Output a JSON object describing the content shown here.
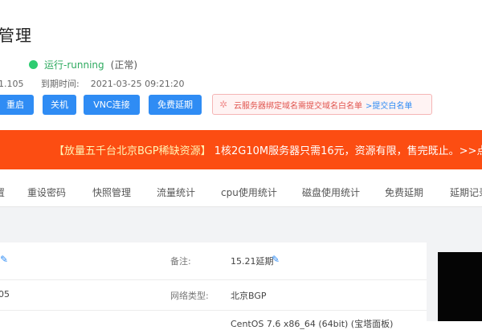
{
  "header": {
    "title_fragment": "管理",
    "status_label": "运行-running",
    "status_normal": "(正常)",
    "ip_fragment": "1.105",
    "expire_label": "到期时间:",
    "expire_value": "2021-03-25 09:21:20"
  },
  "buttons": {
    "restart": "重启",
    "shutdown": "关机",
    "vnc": "VNC连接",
    "extend": "免费延期"
  },
  "notice": {
    "text": "云服务器绑定域名需提交域名白名单",
    "link": ">提交白名单"
  },
  "banner": {
    "bold": "【放量五千台北京BGP稀缺资源】",
    "text": "1核2G10M服务器只需16元，资源有限，售完既止。>>点"
  },
  "tabs": [
    "置",
    "重设密码",
    "快照管理",
    "流量统计",
    "cpu使用统计",
    "磁盘使用统计",
    "免费延期",
    "延期记录"
  ],
  "details": {
    "remark_label": "备注:",
    "remark_value": "15.21延期",
    "ip_partial": "05",
    "network_label": "网络类型:",
    "network_value": "北京BGP",
    "os_partial": "CentOS 7.6 x86_64 (64bit) (宝塔面板)"
  },
  "colors": {
    "primary": "#2f8cf4",
    "banner": "#fc4d12",
    "status_green": "#2ecc71"
  }
}
